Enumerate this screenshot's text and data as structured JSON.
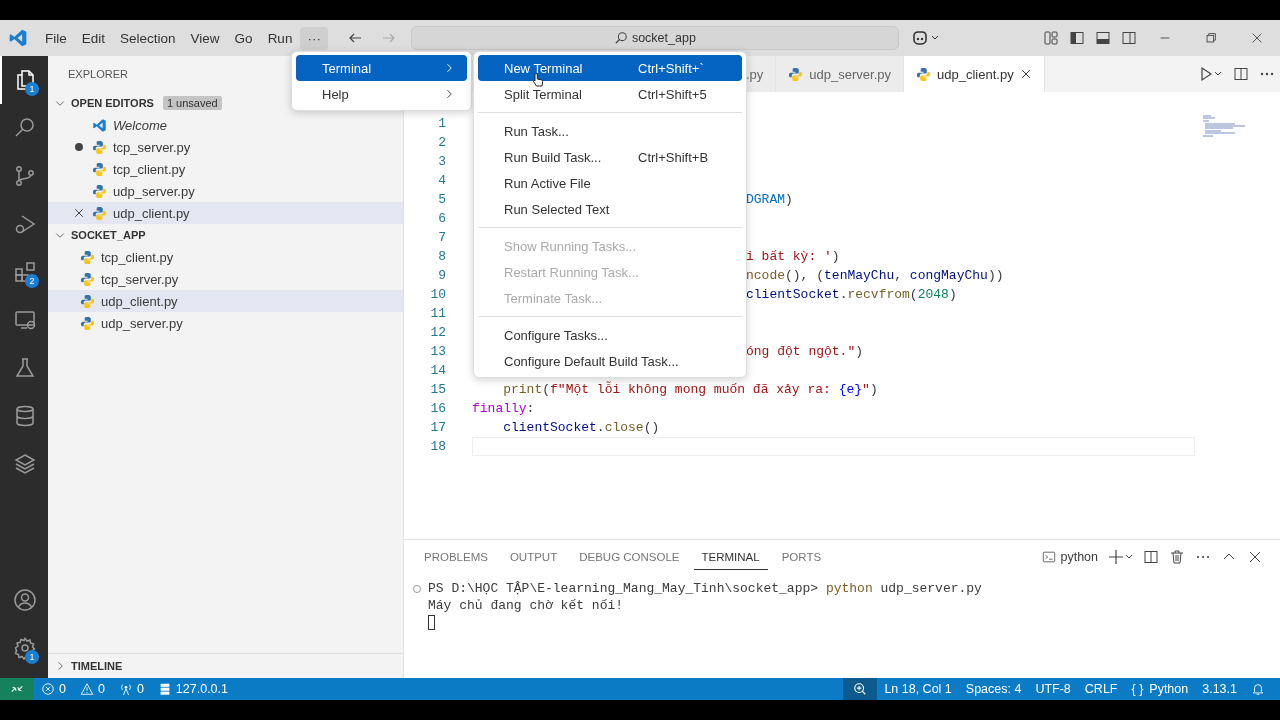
{
  "menubar": {
    "items": [
      {
        "label": "File",
        "selected": false
      },
      {
        "label": "Edit",
        "selected": false
      },
      {
        "label": "Selection",
        "selected": false
      },
      {
        "label": "View",
        "selected": false
      },
      {
        "label": "Go",
        "selected": false
      },
      {
        "label": "Run",
        "selected": false
      },
      {
        "label": "···",
        "selected": true
      }
    ]
  },
  "command_center": {
    "text": "socket_app"
  },
  "overflow_menu": {
    "items": [
      {
        "label": "Terminal",
        "selected": true
      },
      {
        "label": "Help",
        "selected": false
      }
    ]
  },
  "terminal_submenu": {
    "groups": [
      [
        {
          "label": "New Terminal",
          "shortcut": "Ctrl+Shift+`",
          "selected": true,
          "disabled": false
        },
        {
          "label": "Split Terminal",
          "shortcut": "Ctrl+Shift+5",
          "selected": false,
          "disabled": false
        }
      ],
      [
        {
          "label": "Run Task...",
          "selected": false,
          "disabled": false
        },
        {
          "label": "Run Build Task...",
          "shortcut": "Ctrl+Shift+B",
          "selected": false,
          "disabled": false
        },
        {
          "label": "Run Active File",
          "selected": false,
          "disabled": false
        },
        {
          "label": "Run Selected Text",
          "selected": false,
          "disabled": false
        }
      ],
      [
        {
          "label": "Show Running Tasks...",
          "selected": false,
          "disabled": true
        },
        {
          "label": "Restart Running Task...",
          "selected": false,
          "disabled": true
        },
        {
          "label": "Terminate Task...",
          "selected": false,
          "disabled": true
        }
      ],
      [
        {
          "label": "Configure Tasks...",
          "selected": false,
          "disabled": false
        },
        {
          "label": "Configure Default Build Task...",
          "selected": false,
          "disabled": false
        }
      ]
    ]
  },
  "activity_bar": {
    "top": [
      {
        "kind": "explorer",
        "badge": "1",
        "selected": true
      },
      {
        "kind": "search",
        "selected": false
      },
      {
        "kind": "scm",
        "selected": false
      },
      {
        "kind": "debug",
        "selected": false
      },
      {
        "kind": "extensions",
        "badge": "2",
        "selected": false
      },
      {
        "kind": "remote",
        "selected": false
      },
      {
        "kind": "testing",
        "selected": false
      },
      {
        "kind": "database",
        "selected": false
      },
      {
        "kind": "layers",
        "selected": false
      }
    ],
    "bottom": [
      {
        "kind": "account",
        "selected": false
      },
      {
        "kind": "settings",
        "badge": "1",
        "selected": false
      }
    ]
  },
  "sidebar": {
    "title": "EXPLORER",
    "open_editors": {
      "title": "OPEN EDITORS",
      "badge": "1 unsaved",
      "expanded": true,
      "items": [
        {
          "label": "Welcome",
          "kind": "welcome",
          "preview": true,
          "dirty": false,
          "selected": false
        },
        {
          "label": "tcp_server.py",
          "kind": "python",
          "preview": false,
          "dirty": true,
          "selected": false
        },
        {
          "label": "tcp_client.py",
          "kind": "python",
          "preview": false,
          "dirty": false,
          "selected": false
        },
        {
          "label": "udp_server.py",
          "kind": "python",
          "preview": false,
          "dirty": false,
          "selected": false
        },
        {
          "label": "udp_client.py",
          "kind": "python",
          "preview": false,
          "dirty": false,
          "selected": true
        }
      ]
    },
    "folder": {
      "title": "SOCKET_APP",
      "expanded": true,
      "items": [
        {
          "label": "tcp_client.py",
          "kind": "python",
          "selected": false
        },
        {
          "label": "tcp_server.py",
          "kind": "python",
          "selected": false
        },
        {
          "label": "udp_client.py",
          "kind": "python",
          "selected": true
        },
        {
          "label": "udp_server.py",
          "kind": "python",
          "selected": false
        }
      ]
    },
    "timeline": {
      "title": "TIMELINE",
      "expanded": false
    }
  },
  "tabs": [
    {
      "label": ".py",
      "kind": "covered",
      "selected": false
    },
    {
      "label": "udp_server.py",
      "kind": "python",
      "selected": false
    },
    {
      "label": "udp_client.py",
      "kind": "python",
      "selected": true
    }
  ],
  "code": {
    "lines": [
      {
        "number": "1"
      },
      {
        "number": "2"
      },
      {
        "number": "3"
      },
      {
        "number": "4"
      },
      {
        "number": "5",
        "covered": true,
        "tokens": [
          {
            "t": "DGRAM",
            "kind": "const"
          },
          {
            "t": ")",
            "kind": "plain"
          }
        ]
      },
      {
        "number": "6"
      },
      {
        "number": "7"
      },
      {
        "number": "8",
        "covered": true,
        "tokens": [
          {
            "t": "i bất kỳ: '",
            "kind": "string"
          },
          {
            "t": ")",
            "kind": "plain"
          }
        ]
      },
      {
        "number": "9",
        "covered": true,
        "tokens": [
          {
            "t": "ncode",
            "kind": "func"
          },
          {
            "t": "(), (",
            "kind": "plain"
          },
          {
            "t": "tenMayChu",
            "kind": "var"
          },
          {
            "t": ", ",
            "kind": "plain"
          },
          {
            "t": "congMayChu",
            "kind": "var"
          },
          {
            "t": "))",
            "kind": "plain"
          }
        ]
      },
      {
        "number": "10",
        "covered": true,
        "tokens": [
          {
            "t": "clientSocket",
            "kind": "var"
          },
          {
            "t": ".",
            "kind": "plain"
          },
          {
            "t": "recvfrom",
            "kind": "func"
          },
          {
            "t": "(",
            "kind": "plain"
          },
          {
            "t": "2048",
            "kind": "num"
          },
          {
            "t": ")",
            "kind": "plain"
          }
        ]
      },
      {
        "number": "11"
      },
      {
        "number": "12"
      },
      {
        "number": "13",
        "covered": true,
        "tokens": [
          {
            "t": "óng đột ngột.\"",
            "kind": "string"
          },
          {
            "t": ")",
            "kind": "plain"
          }
        ]
      },
      {
        "number": "14"
      },
      {
        "number": "15",
        "tokens": [
          {
            "t": "    print",
            "kind": "func"
          },
          {
            "t": "(",
            "kind": "plain"
          },
          {
            "t": "f\"Một lỗi không mong muốn đã xảy ra: ",
            "kind": "string"
          },
          {
            "t": "{e}",
            "kind": "interp"
          },
          {
            "t": "\"",
            "kind": "string"
          },
          {
            "t": ")",
            "kind": "plain"
          }
        ]
      },
      {
        "number": "16",
        "tokens": [
          {
            "t": "finally",
            "kind": "keyword"
          },
          {
            "t": ":",
            "kind": "plain"
          }
        ]
      },
      {
        "number": "17",
        "tokens": [
          {
            "t": "    clientSocket",
            "kind": "var"
          },
          {
            "t": ".",
            "kind": "plain"
          },
          {
            "t": "close",
            "kind": "func"
          },
          {
            "t": "()",
            "kind": "plain"
          }
        ]
      },
      {
        "number": "18",
        "current": true
      }
    ]
  },
  "panel": {
    "tabs": [
      {
        "label": "PROBLEMS",
        "selected": false
      },
      {
        "label": "OUTPUT",
        "selected": false
      },
      {
        "label": "DEBUG CONSOLE",
        "selected": false
      },
      {
        "label": "TERMINAL",
        "selected": true
      },
      {
        "label": "PORTS",
        "selected": false
      }
    ],
    "profile": "python",
    "terminal_lines": [
      [
        {
          "t": "PS D:\\HỌC TẬP\\E-learning_Mang_May_Tinh\\socket_app> ",
          "kind": "plain"
        },
        {
          "t": "python",
          "kind": "command"
        },
        {
          "t": " udp_server.py",
          "kind": "plain"
        }
      ],
      [
        {
          "t": "Máy chủ đang chờ kết nối!",
          "kind": "plain"
        }
      ]
    ]
  },
  "status_bar": {
    "left": [
      {
        "kind": "remote"
      },
      {
        "kind": "errors",
        "text": "0"
      },
      {
        "kind": "warnings",
        "text": "0"
      },
      {
        "kind": "ports",
        "text": "0"
      },
      {
        "kind": "server",
        "text": "127.0.0.1"
      }
    ],
    "right": [
      {
        "kind": "zoom"
      },
      {
        "kind": "text",
        "text": "Ln 18, Col 1"
      },
      {
        "kind": "text",
        "text": "Spaces: 4"
      },
      {
        "kind": "text",
        "text": "UTF-8"
      },
      {
        "kind": "text",
        "text": "CRLF"
      },
      {
        "kind": "language",
        "icon_text": "{ }",
        "text": "Python"
      },
      {
        "kind": "text",
        "text": "3.13.1"
      },
      {
        "kind": "bell"
      }
    ]
  }
}
